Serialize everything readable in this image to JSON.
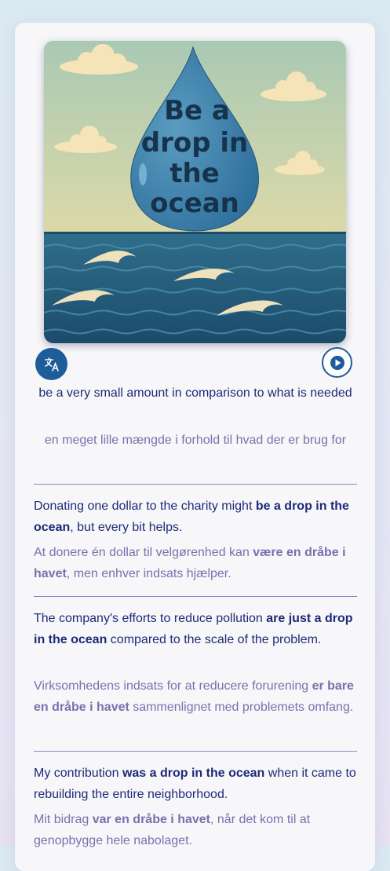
{
  "illustration": {
    "title_lines": [
      "Be a",
      "drop in",
      "the",
      "ocean"
    ]
  },
  "definition": {
    "en": "be a very small amount in comparison to what is needed",
    "da": "en meget lille mængde i forhold til hvad der er brug for"
  },
  "examples": [
    {
      "en": {
        "before": "Donating one dollar to the charity might ",
        "bold": "be a drop in the ocean",
        "after": ", but every bit helps."
      },
      "da": {
        "before": "At donere én dollar til velgørenhed kan ",
        "bold": "være en dråbe i havet",
        "after": ", men enhver indsats hjælper."
      }
    },
    {
      "en": {
        "before": "The company's efforts to reduce pollution ",
        "bold": "are just a drop in the ocean",
        "after": " compared to the scale of the problem."
      },
      "da": {
        "before": "Virksomhedens indsats for at reducere forurening ",
        "bold": "er bare en dråbe i havet",
        "after": " sammenlignet med problemets omfang."
      }
    },
    {
      "en": {
        "before": "My contribution ",
        "bold": "was a drop in the ocean",
        "after": " when it came to rebuilding the entire neighborhood."
      },
      "da": {
        "before": "Mit bidrag ",
        "bold": "var en dråbe i havet",
        "after": ", når det kom til at genopbygge hele nabolaget."
      }
    }
  ],
  "colors": {
    "accent": "#1f5d9a",
    "primary_text": "#1e2a78",
    "secondary_text": "#7b6fae"
  }
}
